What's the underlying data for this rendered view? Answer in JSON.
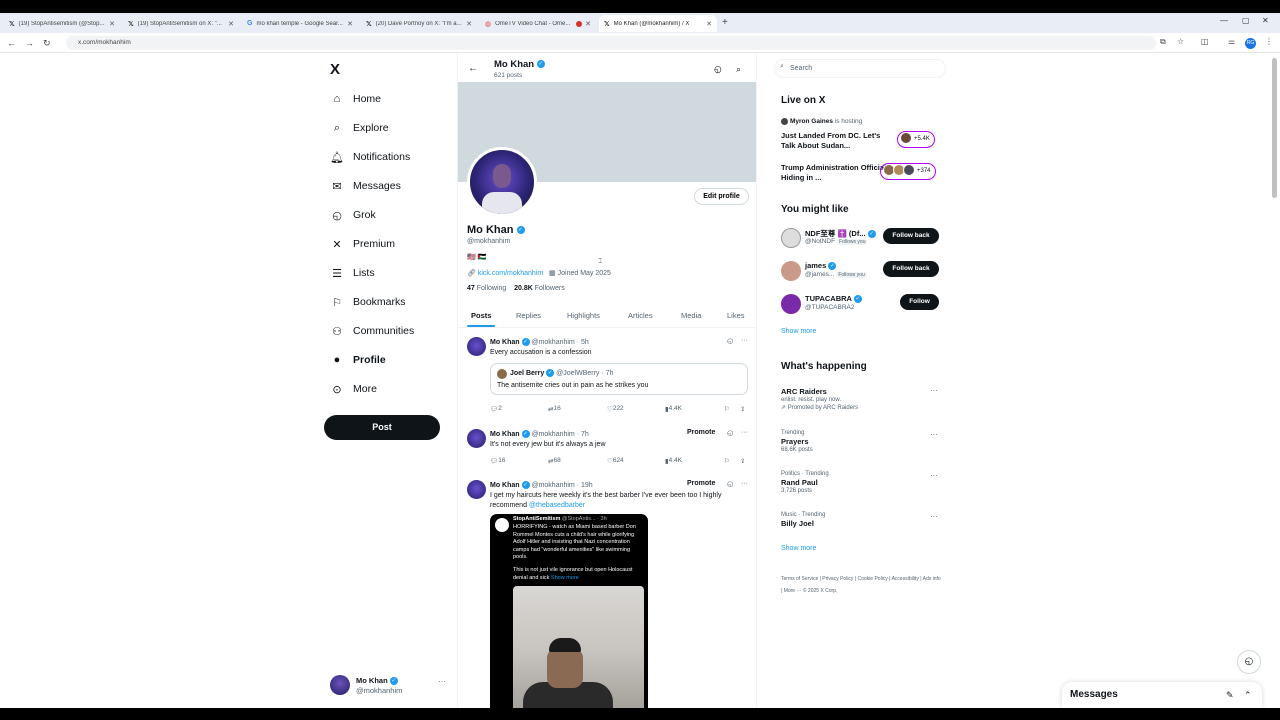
{
  "browser": {
    "tabs": [
      {
        "title": "(19) StopAntisemitism (@Stop...",
        "icon": "x-icon"
      },
      {
        "title": "(19) StopAntiSemitism on X: \"...",
        "icon": "x-icon"
      },
      {
        "title": "mo khan temple - Google Sear...",
        "icon": "google-icon"
      },
      {
        "title": "(20) Dave Portnoy on X: \"I'm a...",
        "icon": "x-icon"
      },
      {
        "title": "OmeTV Video Chat - Ome...",
        "icon": "ometv-icon"
      },
      {
        "title": "Mo Khan (@mokhanhim) / X",
        "icon": "x-icon"
      }
    ],
    "url": "x.com/mokhanhim",
    "profile_initials": "RG"
  },
  "nav": {
    "logo": "X",
    "items": [
      {
        "label": "Home",
        "icon": "home-icon",
        "glyph": "⌂"
      },
      {
        "label": "Explore",
        "icon": "search-icon",
        "glyph": "⌕"
      },
      {
        "label": "Notifications",
        "icon": "bell-icon",
        "glyph": "♫"
      },
      {
        "label": "Messages",
        "icon": "envelope-icon",
        "glyph": "✉"
      },
      {
        "label": "Grok",
        "icon": "grok-icon",
        "glyph": "◵"
      },
      {
        "label": "Premium",
        "icon": "x-premium-icon",
        "glyph": "✕"
      },
      {
        "label": "Lists",
        "icon": "list-icon",
        "glyph": "☰"
      },
      {
        "label": "Bookmarks",
        "icon": "bookmark-icon",
        "glyph": "⚐"
      },
      {
        "label": "Communities",
        "icon": "people-icon",
        "glyph": "⚇"
      },
      {
        "label": "Profile",
        "icon": "person-icon",
        "glyph": "●"
      },
      {
        "label": "More",
        "icon": "more-circle-icon",
        "glyph": "⊙"
      }
    ],
    "post_label": "Post",
    "account": {
      "name": "Mo Khan",
      "handle": "@mokhanhim"
    }
  },
  "header": {
    "name": "Mo Khan",
    "posts": "621 posts"
  },
  "profile": {
    "name": "Mo Khan",
    "handle": "@mokhanhim",
    "flags": "🇺🇸 🇵🇸",
    "link": "kick.com/mokhanhim",
    "joined": "Joined May 2025",
    "following_count": "47",
    "following_label": "Following",
    "followers_count": "20.8K",
    "followers_label": "Followers",
    "edit_label": "Edit profile"
  },
  "profile_tabs": [
    "Posts",
    "Replies",
    "Highlights",
    "Articles",
    "Media",
    "Likes"
  ],
  "tweets": [
    {
      "name": "Mo Khan",
      "handle": "@mokhanhim",
      "time": "5h",
      "text": "Every accusation is a confession",
      "quote": {
        "name": "Joel Berry",
        "handle": "@JoelWBerry",
        "time": "7h",
        "text": "The antisemite cries out in pain as he strikes you"
      },
      "replies": "2",
      "reposts": "16",
      "likes": "222",
      "views": "4.4K"
    },
    {
      "name": "Mo Khan",
      "handle": "@mokhanhim",
      "time": "7h",
      "text": "It's not every jew but it's always a jew",
      "promote": "Promote",
      "replies": "16",
      "reposts": "68",
      "likes": "624",
      "views": "4.4K"
    },
    {
      "name": "Mo Khan",
      "handle": "@mokhanhim",
      "time": "19h",
      "text": "I get my haircuts here weekly it's the best barber I've ever been too I highly recommend",
      "mention": "@thebasedbarber",
      "promote": "Promote",
      "embed": {
        "name": "StopAntiSemitism",
        "handle": "@StopAntis...",
        "time": "3h",
        "text": "HORRIFYING - watch as Miami based barber Don Rommel Montes cuts a child's hair while glorifying Adolf Hitler and insisting that Nazi concentration camps had \"wonderful amenities\" like swimming pools.",
        "text2": "This is not just vile ignorance but open Holocaust denial and sick",
        "show_more": "Show more"
      }
    }
  ],
  "right": {
    "search_placeholder": "Search",
    "live_heading": "Live on X",
    "live": [
      {
        "host": "Myron Gaines",
        "host_suffix": "is hosting",
        "title": "Just Landed From DC. Let's Talk About Sudan...",
        "count": "+5.4K"
      },
      {
        "title": "Trump Administration Officials Hiding in ...",
        "count": "+374"
      }
    ],
    "suggest_heading": "You might like",
    "suggestions": [
      {
        "name": "NDF至尊 ✝️ (Df...",
        "handle": "@NotNDF",
        "follows_you": "Follows you",
        "button": "Follow back"
      },
      {
        "name": "james",
        "handle": "@james...",
        "follows_you": "Follows you",
        "button": "Follow back"
      },
      {
        "name": "TUPACABRA",
        "handle": "@TUPACABRA2",
        "button": "Follow"
      }
    ],
    "show_more": "Show more",
    "happening_heading": "What's happening",
    "trends": [
      {
        "category": "",
        "name": "ARC Raiders",
        "sub": "enlist. resist. play now.",
        "promoted": "Promoted by ARC Raiders"
      },
      {
        "category": "Trending",
        "name": "Prayers",
        "sub": "68.6K posts"
      },
      {
        "category": "Politics · Trending",
        "name": "Rand Paul",
        "sub": "3,726 posts"
      },
      {
        "category": "Music · Trending",
        "name": "Billy Joel",
        "sub": ""
      }
    ],
    "show_more_2": "Show more",
    "footer": "Terms of Service  |  Privacy Policy  |  Cookie Policy  |  Accessibility  |  Ads info  |  More ···  © 2025 X Corp."
  },
  "messages_drawer": {
    "title": "Messages"
  },
  "colors": {
    "accent": "#1d9bf0",
    "text": "#0f1419",
    "muted": "#536471",
    "banner": "#cfd9de",
    "live_ring": "#b400ff"
  }
}
